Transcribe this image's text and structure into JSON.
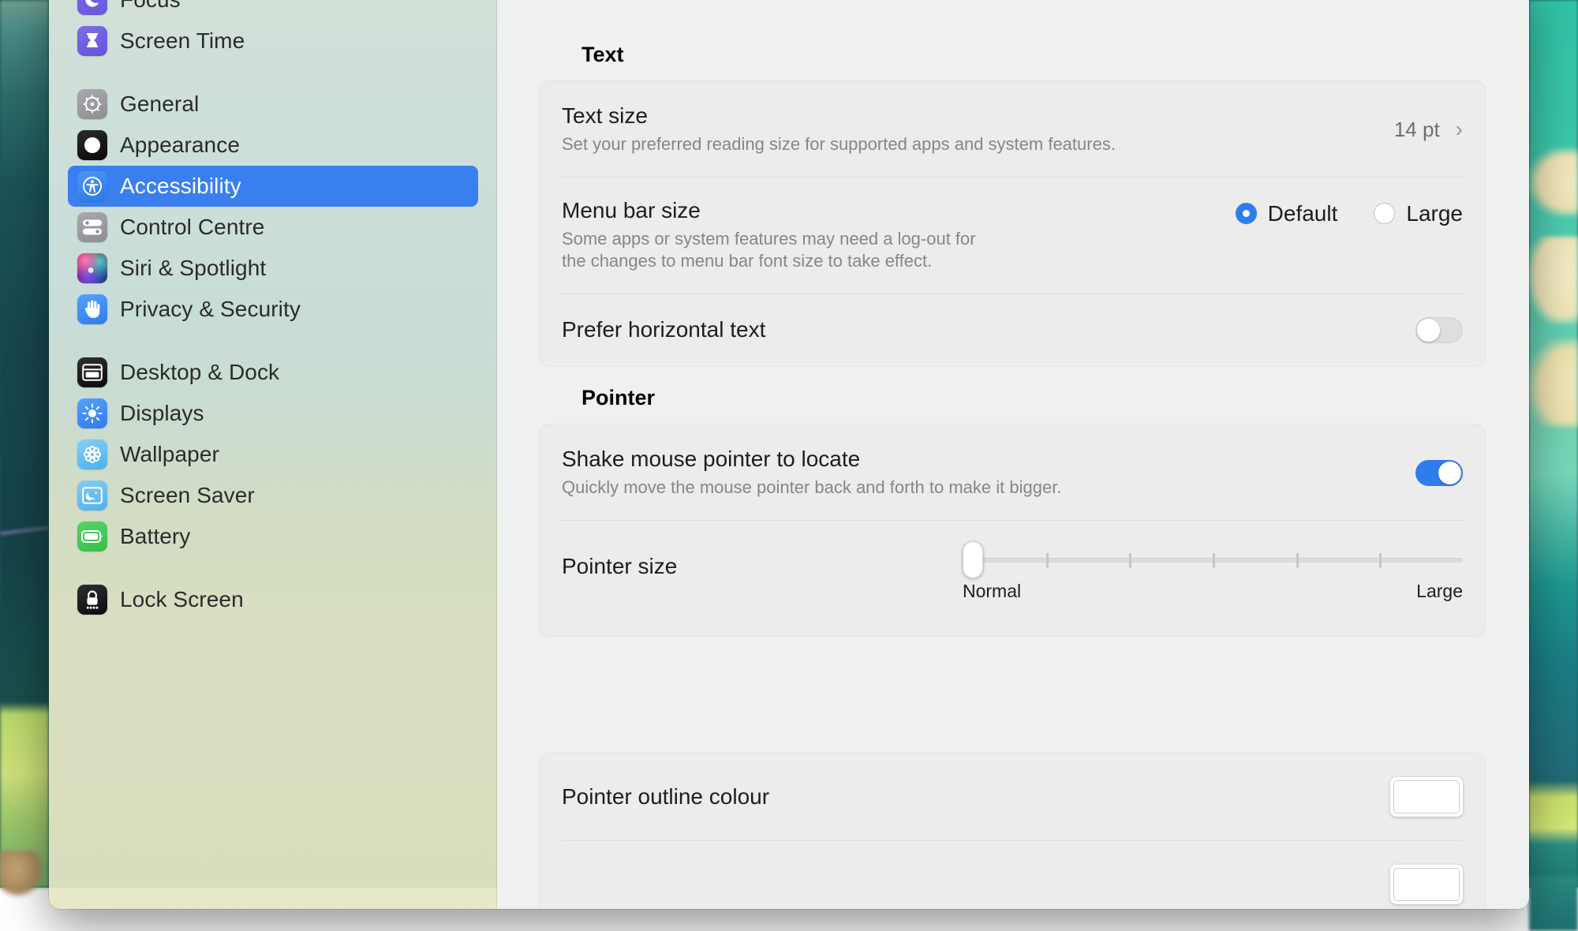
{
  "sidebar": {
    "groups": [
      {
        "items": [
          {
            "label": "Focus",
            "icon": "moon-icon",
            "icon_class": "ic-focus",
            "selected": false
          },
          {
            "label": "Screen Time",
            "icon": "hourglass-icon",
            "icon_class": "ic-screentime",
            "selected": false
          }
        ]
      },
      {
        "items": [
          {
            "label": "General",
            "icon": "gear-icon",
            "icon_class": "ic-general",
            "selected": false
          },
          {
            "label": "Appearance",
            "icon": "appearance-contrast-icon",
            "icon_class": "ic-appearance",
            "selected": false
          },
          {
            "label": "Accessibility",
            "icon": "accessibility-person-icon",
            "icon_class": "ic-access",
            "selected": true
          },
          {
            "label": "Control Centre",
            "icon": "sliders-icon",
            "icon_class": "ic-control",
            "selected": false
          },
          {
            "label": "Siri & Spotlight",
            "icon": "siri-orb-icon",
            "icon_class": "ic-siri",
            "selected": false
          },
          {
            "label": "Privacy & Security",
            "icon": "hand-raised-icon",
            "icon_class": "ic-privacy",
            "selected": false
          }
        ]
      },
      {
        "items": [
          {
            "label": "Desktop & Dock",
            "icon": "desktop-window-icon",
            "icon_class": "ic-desktop",
            "selected": false
          },
          {
            "label": "Displays",
            "icon": "brightness-sun-icon",
            "icon_class": "ic-displays",
            "selected": false
          },
          {
            "label": "Wallpaper",
            "icon": "flower-icon",
            "icon_class": "ic-wallpaper",
            "selected": false
          },
          {
            "label": "Screen Saver",
            "icon": "screensaver-moon-icon",
            "icon_class": "ic-saver",
            "selected": false
          },
          {
            "label": "Battery",
            "icon": "battery-icon",
            "icon_class": "ic-battery",
            "selected": false
          }
        ]
      },
      {
        "items": [
          {
            "label": "Lock Screen",
            "icon": "padlock-icon",
            "icon_class": "ic-lock",
            "selected": false
          }
        ]
      }
    ]
  },
  "content": {
    "text_section": {
      "title": "Text",
      "text_size": {
        "title": "Text size",
        "subtitle": "Set your preferred reading size for supported apps and system features.",
        "value": "14 pt",
        "chevron": "›"
      },
      "menu_bar_size": {
        "title": "Menu bar size",
        "subtitle_line1": "Some apps or system features may need a log-out for",
        "subtitle_line2": "the changes to menu bar font size to take effect.",
        "options": [
          {
            "label": "Default",
            "selected": true
          },
          {
            "label": "Large",
            "selected": false
          }
        ]
      },
      "prefer_horizontal_text": {
        "title": "Prefer horizontal text",
        "enabled": false
      }
    },
    "pointer_section": {
      "title": "Pointer",
      "shake_to_locate": {
        "title": "Shake mouse pointer to locate",
        "subtitle": "Quickly move the mouse pointer back and forth to make it bigger.",
        "enabled": true
      },
      "pointer_size": {
        "title": "Pointer size",
        "min_label": "Normal",
        "max_label": "Large",
        "value": 0,
        "ticks": 5
      },
      "pointer_outline_colour": {
        "title": "Pointer outline colour",
        "colour": "#ffffff"
      }
    }
  },
  "colors": {
    "accent": "#2f7ced",
    "selection": "#3a7ff0",
    "card_bg": "#ececec",
    "content_bg": "#eff0f0"
  }
}
